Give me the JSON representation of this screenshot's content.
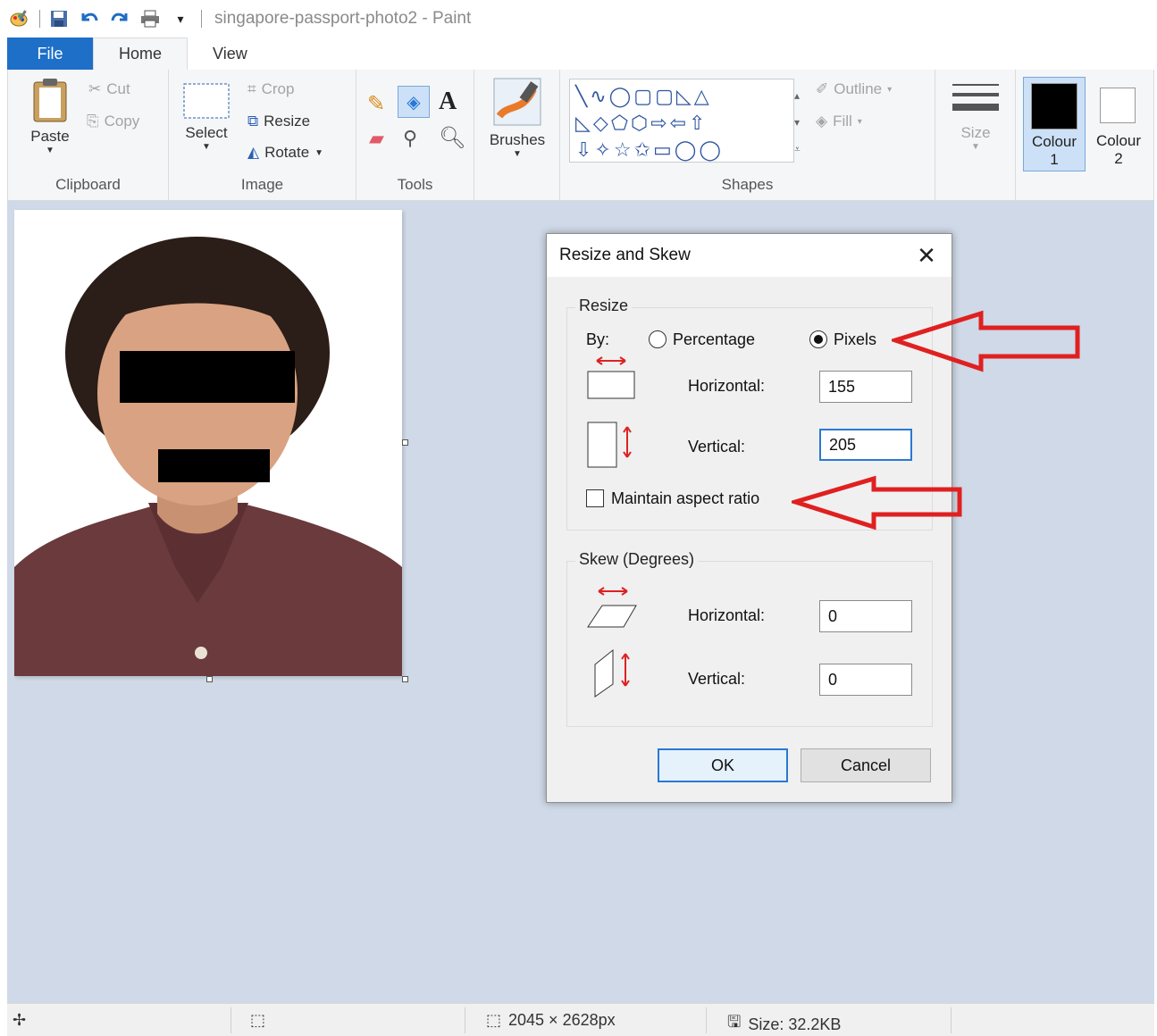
{
  "window": {
    "title": "singapore-passport-photo2 - Paint"
  },
  "tabs": {
    "file": "File",
    "home": "Home",
    "view": "View"
  },
  "ribbon": {
    "clipboard": {
      "label": "Clipboard",
      "paste": "Paste",
      "cut": "Cut",
      "copy": "Copy"
    },
    "image": {
      "label": "Image",
      "select": "Select",
      "crop": "Crop",
      "resize": "Resize",
      "rotate": "Rotate"
    },
    "tools": {
      "label": "Tools"
    },
    "brushes": {
      "label": "Brushes"
    },
    "shapes": {
      "label": "Shapes",
      "outline": "Outline",
      "fill": "Fill"
    },
    "size": {
      "label": "Size"
    },
    "colour1": {
      "label": "Colour",
      "number": "1",
      "color": "#000000"
    },
    "colour2": {
      "label": "Colour",
      "number": "2",
      "color": "#ffffff"
    }
  },
  "status": {
    "dimensions": "2045 × 2628px",
    "size": "Size: 32.2KB"
  },
  "dialog": {
    "title": "Resize and Skew",
    "resize_legend": "Resize",
    "by_label": "By:",
    "percentage_label": "Percentage",
    "pixels_label": "Pixels",
    "selected_mode": "Pixels",
    "horizontal_label": "Horizontal:",
    "horizontal_value": "155",
    "vertical_label": "Vertical:",
    "vertical_value": "205",
    "maintain_aspect_label": "Maintain aspect ratio",
    "maintain_aspect_checked": false,
    "skew_legend": "Skew (Degrees)",
    "skew_horizontal_label": "Horizontal:",
    "skew_horizontal_value": "0",
    "skew_vertical_label": "Vertical:",
    "skew_vertical_value": "0",
    "ok_label": "OK",
    "cancel_label": "Cancel"
  },
  "colors": {
    "file_tab": "#1e6fc8",
    "workspace": "#cfd9e7",
    "annotation_arrow": "#e02020"
  }
}
